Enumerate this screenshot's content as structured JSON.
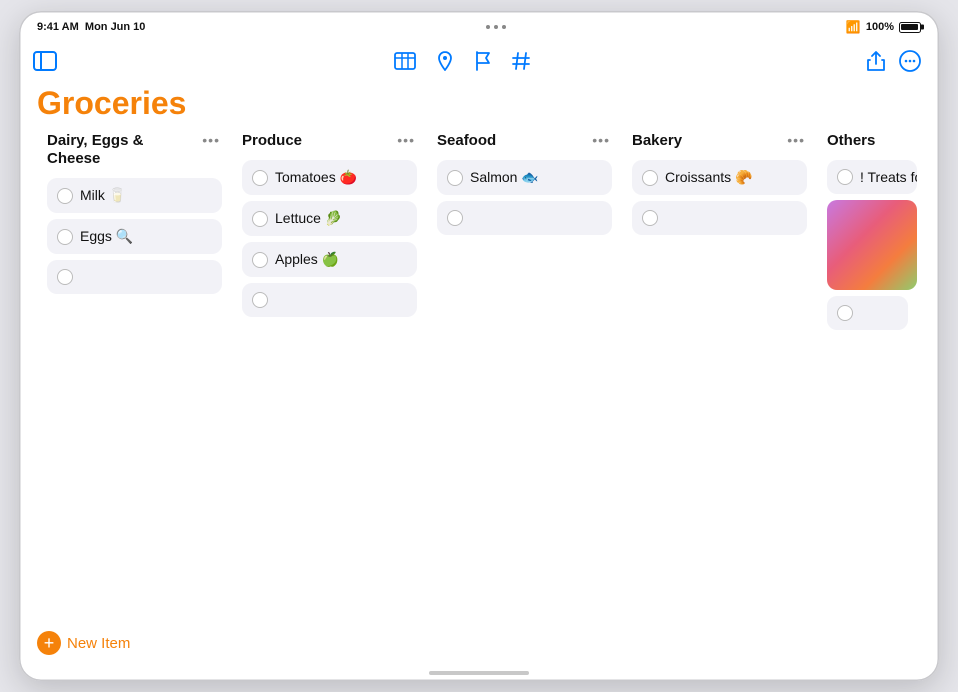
{
  "status_bar": {
    "time": "9:41 AM",
    "date": "Mon Jun 10",
    "wifi": "WiFi",
    "battery_percent": "100%"
  },
  "toolbar": {
    "sidebar_toggle_label": "Sidebar Toggle",
    "table_icon_label": "Table",
    "location_icon_label": "Location",
    "flag_icon_label": "Flag",
    "hashtag_icon_label": "Hashtag",
    "share_icon_label": "Share",
    "more_icon_label": "More"
  },
  "page": {
    "title": "Groceries"
  },
  "columns": [
    {
      "id": "dairy",
      "title": "Dairy, Eggs & Cheese",
      "items": [
        {
          "text": "Milk 🥛",
          "checked": false
        },
        {
          "text": "Eggs 🔍",
          "checked": false
        }
      ],
      "empty_slots": 1
    },
    {
      "id": "produce",
      "title": "Produce",
      "items": [
        {
          "text": "Tomatoes 🍅",
          "checked": false
        },
        {
          "text": "Lettuce 🥬",
          "checked": false
        },
        {
          "text": "Apples 🍏",
          "checked": false
        }
      ],
      "empty_slots": 1
    },
    {
      "id": "seafood",
      "title": "Seafood",
      "items": [
        {
          "text": "Salmon 🐟",
          "checked": false
        }
      ],
      "empty_slots": 1
    },
    {
      "id": "bakery",
      "title": "Bakery",
      "items": [
        {
          "text": "Croissants 🥐",
          "checked": false
        }
      ],
      "empty_slots": 1
    },
    {
      "id": "others",
      "title": "Others",
      "items": [
        {
          "text": "! Treats for",
          "checked": false
        }
      ],
      "has_image": true,
      "empty_slots": 1
    }
  ],
  "bottom": {
    "new_item_label": "New Item",
    "new_item_plus": "+"
  }
}
